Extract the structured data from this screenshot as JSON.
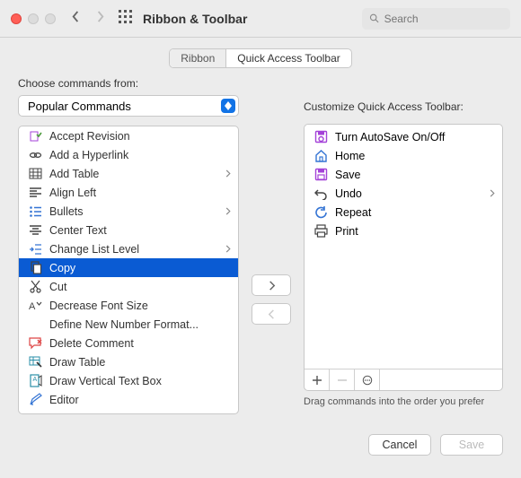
{
  "window": {
    "title": "Ribbon & Toolbar",
    "search_placeholder": "Search"
  },
  "tabs": {
    "ribbon": "Ribbon",
    "qat": "Quick Access Toolbar"
  },
  "left": {
    "label": "Choose commands from:",
    "select_value": "Popular Commands",
    "items": [
      {
        "label": "Accept Revision",
        "icon": "accept",
        "color": "c-purple"
      },
      {
        "label": "Add a Hyperlink",
        "icon": "link",
        "color": "c-dark"
      },
      {
        "label": "Add Table",
        "icon": "table",
        "color": "c-dark",
        "submenu": true
      },
      {
        "label": "Align Left",
        "icon": "alignleft",
        "color": "c-dark"
      },
      {
        "label": "Bullets",
        "icon": "bullets",
        "color": "c-blue",
        "submenu": true
      },
      {
        "label": "Center Text",
        "icon": "center",
        "color": "c-dark"
      },
      {
        "label": "Change List Level",
        "icon": "listlevel",
        "color": "c-blue",
        "submenu": true
      },
      {
        "label": "Copy",
        "icon": "copy",
        "color": "c-dark",
        "selected": true
      },
      {
        "label": "Cut",
        "icon": "cut",
        "color": "c-dark"
      },
      {
        "label": "Decrease Font Size",
        "icon": "fontdown",
        "color": "c-dark"
      },
      {
        "label": "Define New Number Format...",
        "icon": "blank",
        "color": "c-dark"
      },
      {
        "label": "Delete Comment",
        "icon": "delcomment",
        "color": "c-red"
      },
      {
        "label": "Draw Table",
        "icon": "drawtable",
        "color": "c-teal"
      },
      {
        "label": "Draw Vertical Text Box",
        "icon": "vtextbox",
        "color": "c-teal"
      },
      {
        "label": "Editor",
        "icon": "editor",
        "color": "c-blue"
      }
    ]
  },
  "right": {
    "label": "Customize Quick Access Toolbar:",
    "items": [
      {
        "label": "Turn AutoSave On/Off",
        "icon": "autosave",
        "color": "c-purple"
      },
      {
        "label": "Home",
        "icon": "home",
        "color": "c-blue"
      },
      {
        "label": "Save",
        "icon": "save",
        "color": "c-purple"
      },
      {
        "label": "Undo",
        "icon": "undo",
        "color": "c-dark",
        "submenu": true
      },
      {
        "label": "Repeat",
        "icon": "repeat",
        "color": "c-blue"
      },
      {
        "label": "Print",
        "icon": "print",
        "color": "c-dark"
      }
    ],
    "hint": "Drag commands into the order you prefer"
  },
  "footer": {
    "cancel": "Cancel",
    "save": "Save"
  }
}
